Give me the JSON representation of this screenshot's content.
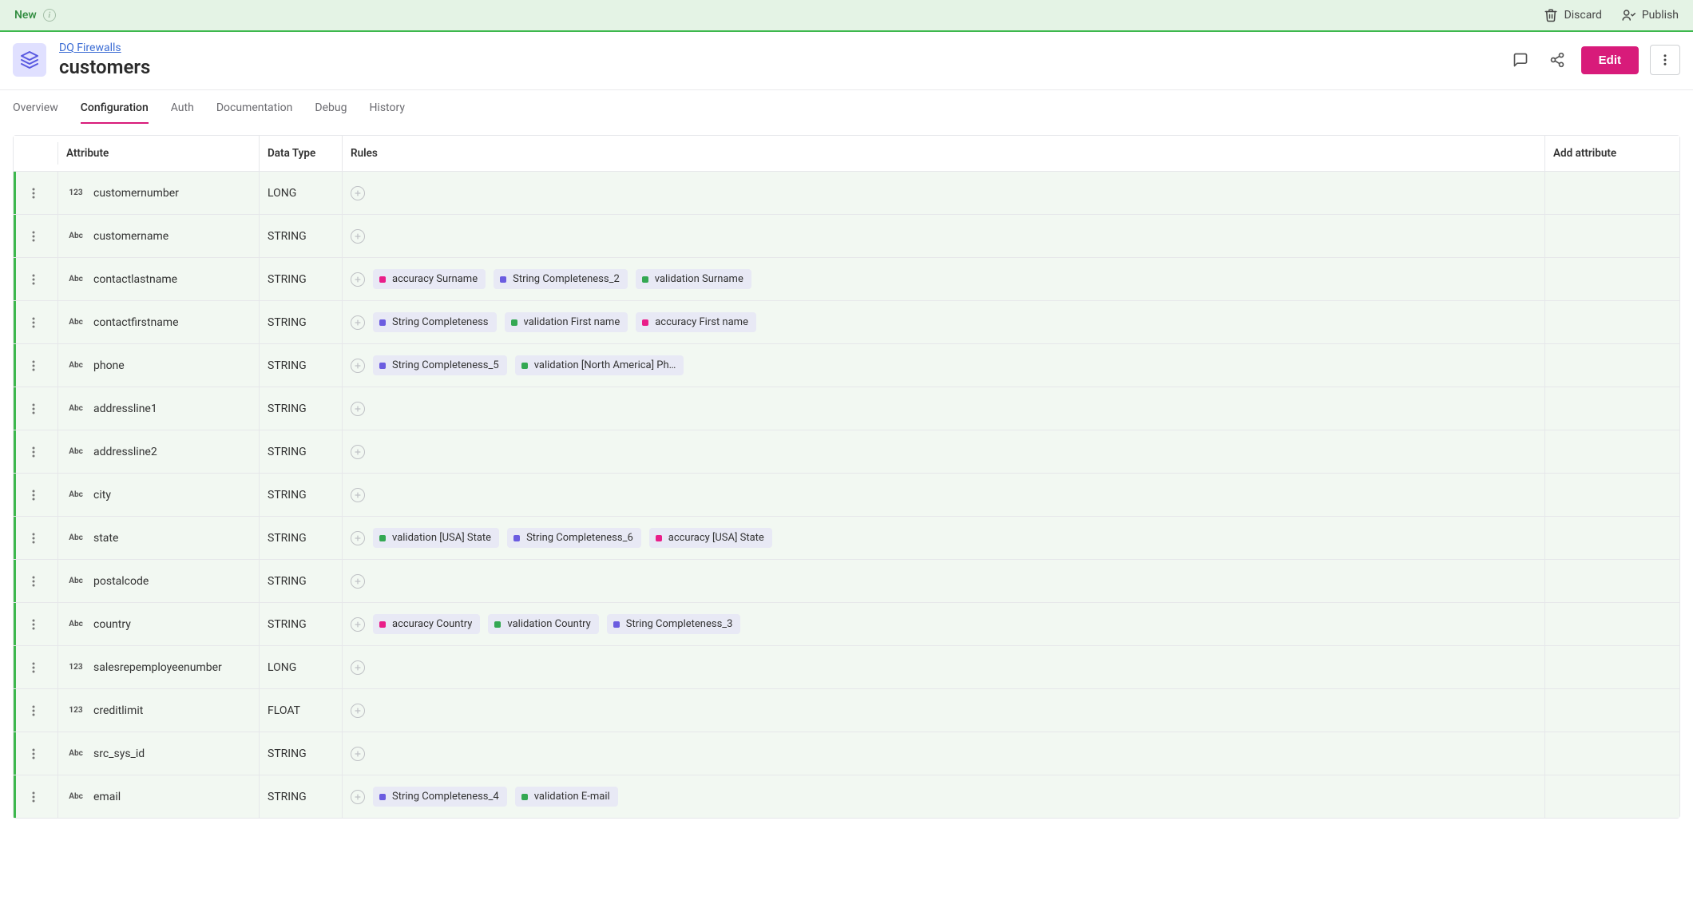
{
  "status_bar": {
    "label": "New",
    "discard": "Discard",
    "publish": "Publish"
  },
  "header": {
    "breadcrumb": "DQ Firewalls",
    "title": "customers",
    "edit": "Edit"
  },
  "tabs": [
    {
      "label": "Overview",
      "active": false
    },
    {
      "label": "Configuration",
      "active": true
    },
    {
      "label": "Auth",
      "active": false
    },
    {
      "label": "Documentation",
      "active": false
    },
    {
      "label": "Debug",
      "active": false
    },
    {
      "label": "History",
      "active": false
    }
  ],
  "table": {
    "columns": {
      "attribute": "Attribute",
      "data_type": "Data Type",
      "rules": "Rules",
      "add_attribute": "Add attribute"
    },
    "colors": {
      "pink": "#e91e89",
      "purple": "#6b5ce0",
      "green": "#34a853"
    },
    "type_labels": {
      "LONG": "123",
      "STRING": "Abc",
      "FLOAT": "123"
    },
    "rows": [
      {
        "name": "customernumber",
        "type": "LONG",
        "rules": []
      },
      {
        "name": "customername",
        "type": "STRING",
        "rules": []
      },
      {
        "name": "contactlastname",
        "type": "STRING",
        "rules": [
          {
            "color": "pink",
            "label": "accuracy Surname"
          },
          {
            "color": "purple",
            "label": "String Completeness_2"
          },
          {
            "color": "green",
            "label": "validation Surname"
          }
        ]
      },
      {
        "name": "contactfirstname",
        "type": "STRING",
        "rules": [
          {
            "color": "purple",
            "label": "String Completeness"
          },
          {
            "color": "green",
            "label": "validation First name"
          },
          {
            "color": "pink",
            "label": "accuracy First name"
          }
        ]
      },
      {
        "name": "phone",
        "type": "STRING",
        "rules": [
          {
            "color": "purple",
            "label": "String Completeness_5"
          },
          {
            "color": "green",
            "label": "validation [North America] Ph…"
          }
        ]
      },
      {
        "name": "addressline1",
        "type": "STRING",
        "rules": []
      },
      {
        "name": "addressline2",
        "type": "STRING",
        "rules": []
      },
      {
        "name": "city",
        "type": "STRING",
        "rules": []
      },
      {
        "name": "state",
        "type": "STRING",
        "rules": [
          {
            "color": "green",
            "label": "validation [USA] State"
          },
          {
            "color": "purple",
            "label": "String Completeness_6"
          },
          {
            "color": "pink",
            "label": "accuracy [USA] State"
          }
        ]
      },
      {
        "name": "postalcode",
        "type": "STRING",
        "rules": []
      },
      {
        "name": "country",
        "type": "STRING",
        "rules": [
          {
            "color": "pink",
            "label": "accuracy Country"
          },
          {
            "color": "green",
            "label": "validation Country"
          },
          {
            "color": "purple",
            "label": "String Completeness_3"
          }
        ]
      },
      {
        "name": "salesrepemployeenumber",
        "type": "LONG",
        "rules": []
      },
      {
        "name": "creditlimit",
        "type": "FLOAT",
        "rules": []
      },
      {
        "name": "src_sys_id",
        "type": "STRING",
        "rules": []
      },
      {
        "name": "email",
        "type": "STRING",
        "rules": [
          {
            "color": "purple",
            "label": "String Completeness_4"
          },
          {
            "color": "green",
            "label": "validation E-mail"
          }
        ]
      }
    ]
  }
}
